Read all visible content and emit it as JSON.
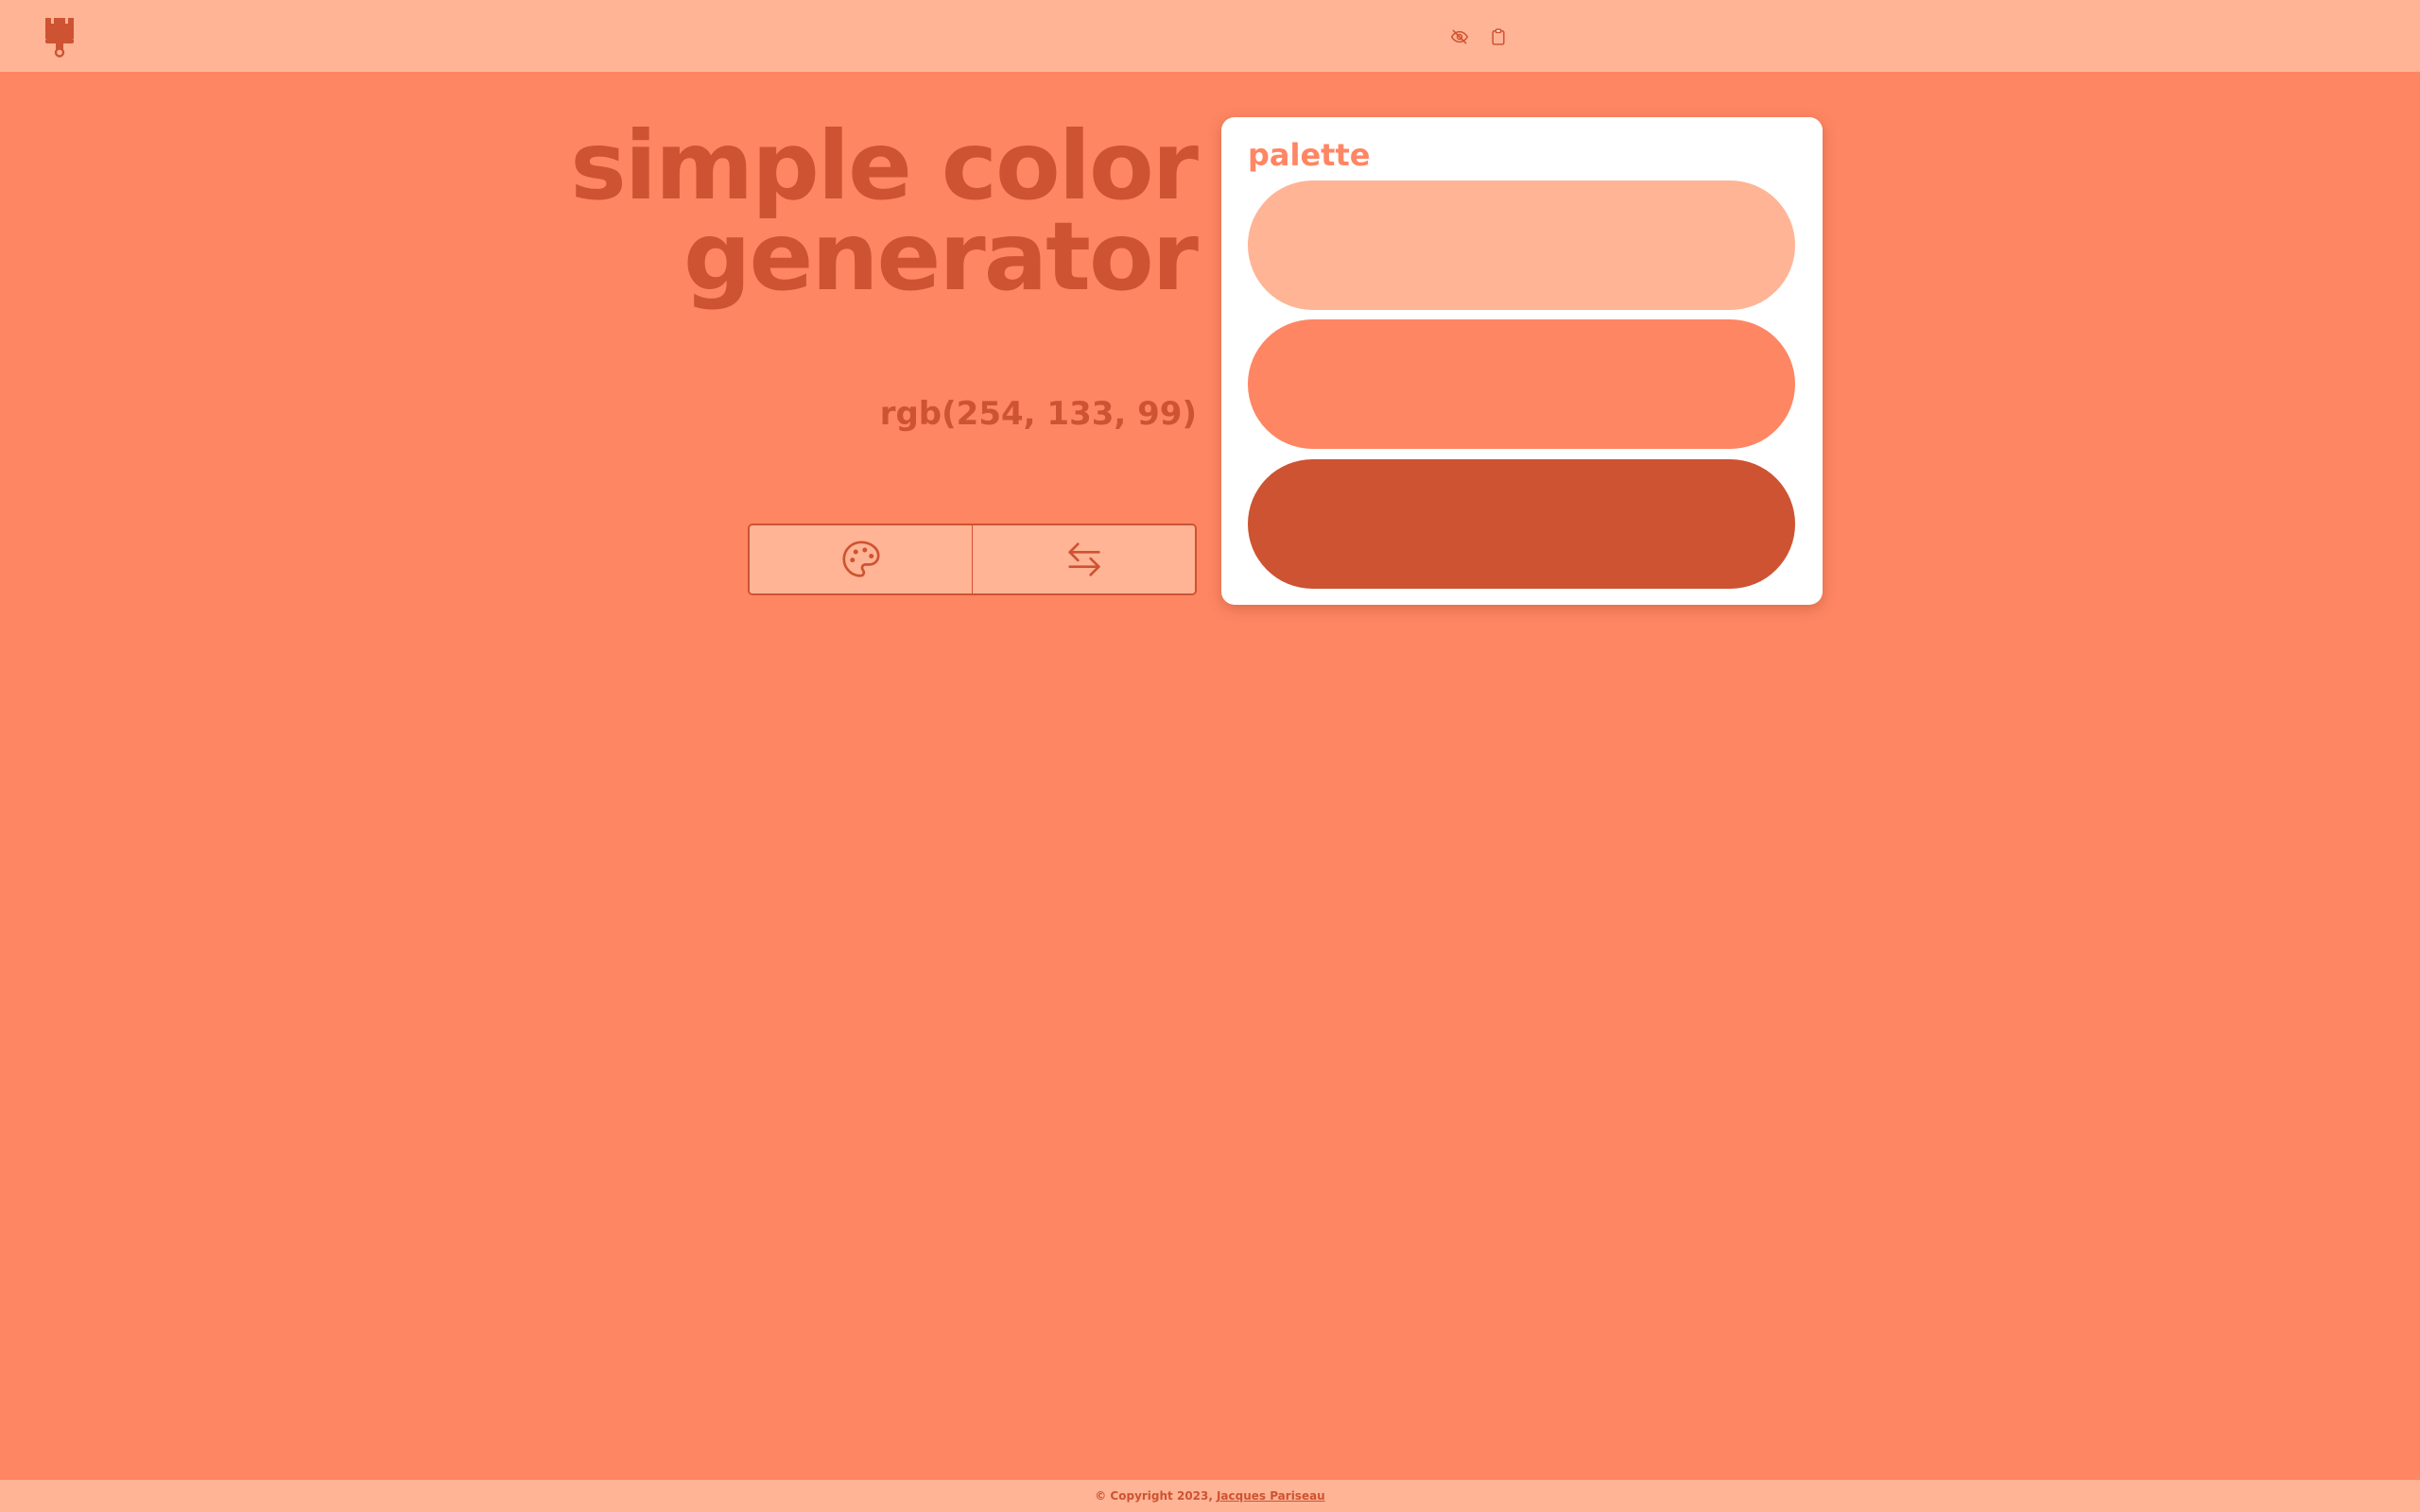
{
  "colors": {
    "background": "#fe8663",
    "light": "#ffb495",
    "dark": "#cd5332",
    "card": "#ffffff"
  },
  "header": {
    "logo_icon": "paint-brush-icon"
  },
  "main": {
    "title_line1": "simple color",
    "title_line2": "generator",
    "rgb_value": "rgb(254, 133, 99)",
    "buttons": [
      {
        "icon": "palette-icon"
      },
      {
        "icon": "swap-arrows-icon"
      }
    ]
  },
  "palette": {
    "title": "palette",
    "icons": [
      "eye-off-icon",
      "clipboard-icon"
    ],
    "swatches": [
      "#ffb495",
      "#fe8663",
      "#cd5332"
    ]
  },
  "footer": {
    "copyright": "© Copyright 2023,",
    "author": "Jacques Pariseau"
  }
}
